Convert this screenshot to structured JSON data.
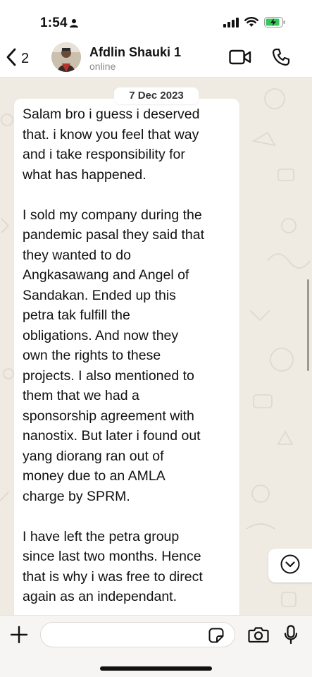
{
  "status_bar": {
    "time": "1:54"
  },
  "header": {
    "back_count": "2",
    "contact_name": "Afdlin Shauki 1",
    "contact_status": "online"
  },
  "chat": {
    "date_chip": "7 Dec 2023",
    "message_paragraphs": [
      "Salam bro i guess i deserved\nthat.  i know you feel that way\nand i take responsibility for\nwhat has happened.",
      "I sold my company during the\npandemic pasal they said that\nthey wanted to do\nAngkasawang and Angel of\nSandakan. Ended up this\npetra tak fulfill the\nobligations. And now they\nown the rights to these\nprojects. I also mentioned to\nthem that we had a\nsponsorship agreement with\nnanostix. But later i found out\nyang diorang ran out of\nmoney due to an AMLA\ncharge by SPRM.",
      "I have left the petra group\nsince last two months. Hence\nthat is why i was free to direct\nagain as an independant."
    ]
  },
  "icons": {
    "back": "chevron-left-icon",
    "video": "video-camera-icon",
    "call": "phone-icon",
    "scroll_down": "chevron-down-circle-icon",
    "attach": "plus-icon",
    "sticker": "sticker-icon",
    "camera": "camera-icon",
    "mic": "microphone-icon"
  },
  "colors": {
    "chat_background": "#efeae2",
    "bubble": "#ffffff",
    "battery": "#34c759"
  }
}
